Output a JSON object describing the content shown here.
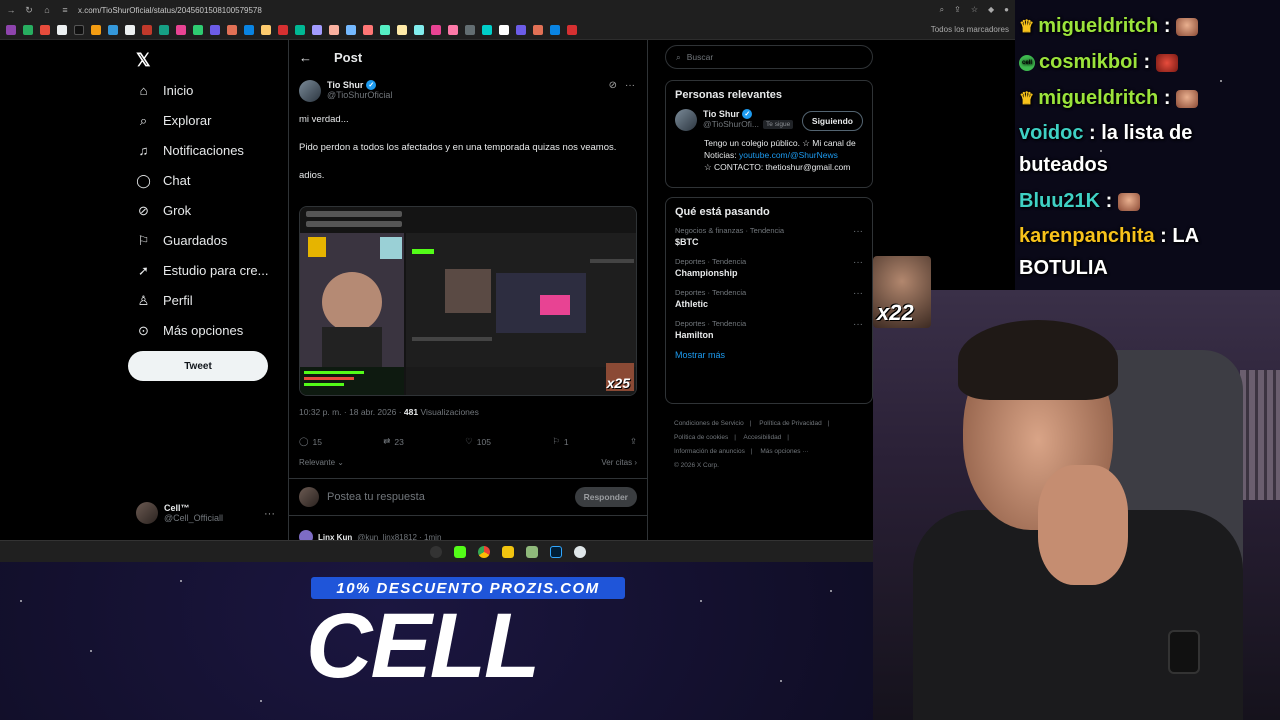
{
  "browser": {
    "url": "x.com/TioShurOficial/status/2045601508100579578",
    "bookmarks_more": "Todos los marcadores"
  },
  "nav": {
    "items": [
      {
        "label": "Inicio",
        "icon": "home-icon"
      },
      {
        "label": "Explorar",
        "icon": "search-icon"
      },
      {
        "label": "Notificaciones",
        "icon": "bell-icon"
      },
      {
        "label": "Chat",
        "icon": "chat-icon"
      },
      {
        "label": "Grok",
        "icon": "grok-icon"
      },
      {
        "label": "Guardados",
        "icon": "bookmark-icon"
      },
      {
        "label": "Estudio para cre...",
        "icon": "rocket-icon"
      },
      {
        "label": "Perfil",
        "icon": "person-icon"
      },
      {
        "label": "Más opciones",
        "icon": "more-circle-icon"
      }
    ],
    "tweet_button": "Tweet",
    "me": {
      "name": "Cell™",
      "handle": "@Cell_Officiall"
    }
  },
  "post": {
    "header": "Post",
    "author_name": "Tio Shur",
    "author_handle": "@TioShurOficial",
    "text_1": "mi verdad...",
    "text_2": "Pido perdon a todos los afectados y en una temporada quizas nos veamos.",
    "text_3": "adios.",
    "timestamp": "10:32 p. m. · 18 abr. 2026 · ",
    "views_count": "481",
    "views_label": " Visualizaciones",
    "replies": "15",
    "reposts": "23",
    "likes": "105",
    "bookmarks": "1",
    "relevance": "Relevante",
    "quotes": "Ver citas",
    "reply_placeholder": "Postea tu respuesta",
    "reply_button": "Responder",
    "next_reply_author": "Linx Kun",
    "next_reply_handle": "@kun_linx81812 · 1min",
    "media_counter": "x25"
  },
  "right": {
    "search_placeholder": "Buscar",
    "relevant_title": "Personas relevantes",
    "person_name": "Tio Shur",
    "person_handle": "@TioShurOfi...",
    "person_tag": "Te sigue",
    "follow_label": "Siguiendo",
    "bio_1": "Tengo un colegio público. ☆ Mi canal de Noticias: ",
    "bio_link": "youtube.com/@ShurNews",
    "bio_2": "☆ CONTACTO: thetioshur@gmail.com",
    "trending_title": "Qué está pasando",
    "trends": [
      {
        "category": "Negocios & finanzas · Tendencia",
        "title": "$BTC"
      },
      {
        "category": "Deportes · Tendencia",
        "title": "Championship"
      },
      {
        "category": "Deportes · Tendencia",
        "title": "Athletic"
      },
      {
        "category": "Deportes · Tendencia",
        "title": "Hamilton"
      }
    ],
    "show_more": "Mostrar más",
    "footer": [
      "Condiciones de Servicio",
      "|",
      "Política de Privacidad",
      "|",
      "Política de cookies",
      "|",
      "Accesibilidad",
      "|",
      "Información de anuncios",
      "|",
      "Más opciones ···",
      "© 2026 X Corp."
    ]
  },
  "chat": [
    {
      "badge": "crown",
      "user": "migueldritch",
      "color": "#9be33b",
      "message": "",
      "emote": true
    },
    {
      "badge": "cell",
      "user": "cosmikboi",
      "color": "#9be33b",
      "message": "",
      "emote": true
    },
    {
      "badge": "crown",
      "user": "migueldritch",
      "color": "#9be33b",
      "message": "",
      "emote": true
    },
    {
      "badge": "",
      "user": "voidoc",
      "color": "#3fd1c4",
      "message": "la lista de",
      "emote": false
    },
    {
      "badge": "",
      "user": "",
      "color": "#ffffff",
      "message": "buteados",
      "emote": false
    },
    {
      "badge": "",
      "user": "Bluu21K",
      "color": "#3fd1c4",
      "message": "",
      "emote": true
    },
    {
      "badge": "",
      "user": "karenpanchita",
      "color": "#f7c21b",
      "message": "LA",
      "emote": false
    },
    {
      "badge": "",
      "user": "",
      "color": "#ffffff",
      "message": "BOTULIA",
      "emote": false
    }
  ],
  "overlay": {
    "emote_count": "x22",
    "sponsor_banner": "10% DESCUENTO PROZIS.COM",
    "sponsor_logo": "CELL"
  }
}
